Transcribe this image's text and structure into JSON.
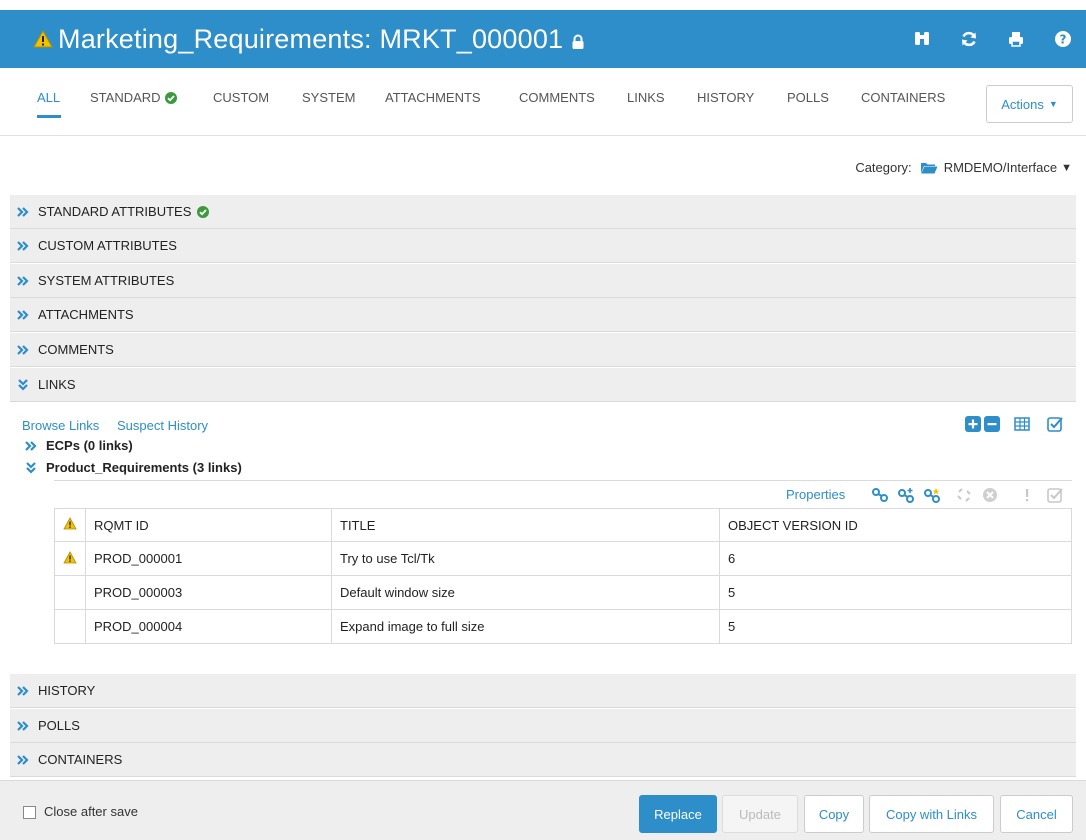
{
  "header": {
    "title": "Marketing_Requirements: MRKT_000001",
    "icons": [
      "search-icon",
      "refresh-icon",
      "print-icon",
      "help-icon"
    ]
  },
  "tabs": [
    {
      "label": "ALL",
      "active": true
    },
    {
      "label": "STANDARD",
      "check": true
    },
    {
      "label": "CUSTOM"
    },
    {
      "label": "SYSTEM"
    },
    {
      "label": "ATTACHMENTS"
    },
    {
      "label": "COMMENTS"
    },
    {
      "label": "LINKS"
    },
    {
      "label": "HISTORY"
    },
    {
      "label": "POLLS"
    },
    {
      "label": "CONTAINERS"
    }
  ],
  "actions_label": "Actions",
  "category": {
    "label": "Category:",
    "value": "RMDEMO/Interface"
  },
  "sections": {
    "standard": "STANDARD ATTRIBUTES",
    "custom": "CUSTOM ATTRIBUTES",
    "system": "SYSTEM ATTRIBUTES",
    "attachments": "ATTACHMENTS",
    "comments": "COMMENTS",
    "links": "LINKS",
    "history": "HISTORY",
    "polls": "POLLS",
    "containers": "CONTAINERS"
  },
  "links_panel": {
    "browse_links": "Browse Links",
    "suspect_history": "Suspect History",
    "groups": [
      {
        "label": "ECPs (0 links)",
        "expanded": false
      },
      {
        "label": "Product_Requirements (3 links)",
        "expanded": true
      }
    ],
    "properties_label": "Properties",
    "table": {
      "columns": [
        "RQMT ID",
        "TITLE",
        "OBJECT VERSION ID"
      ],
      "rows": [
        {
          "warning": true,
          "id": "PROD_000001",
          "title": "Try to use Tcl/Tk",
          "version": "6"
        },
        {
          "warning": false,
          "id": "PROD_000003",
          "title": "Default window size",
          "version": "5"
        },
        {
          "warning": false,
          "id": "PROD_000004",
          "title": "Expand image to full size",
          "version": "5"
        }
      ]
    }
  },
  "footer": {
    "close_after_save": "Close after save",
    "close_after_save_checked": false,
    "buttons": {
      "replace": "Replace",
      "update": "Update",
      "copy": "Copy",
      "copy_with_links": "Copy with Links",
      "cancel": "Cancel"
    }
  },
  "colors": {
    "accent": "#2d8ec9",
    "ok": "#3c9a3c",
    "warning": "#f2c200"
  }
}
